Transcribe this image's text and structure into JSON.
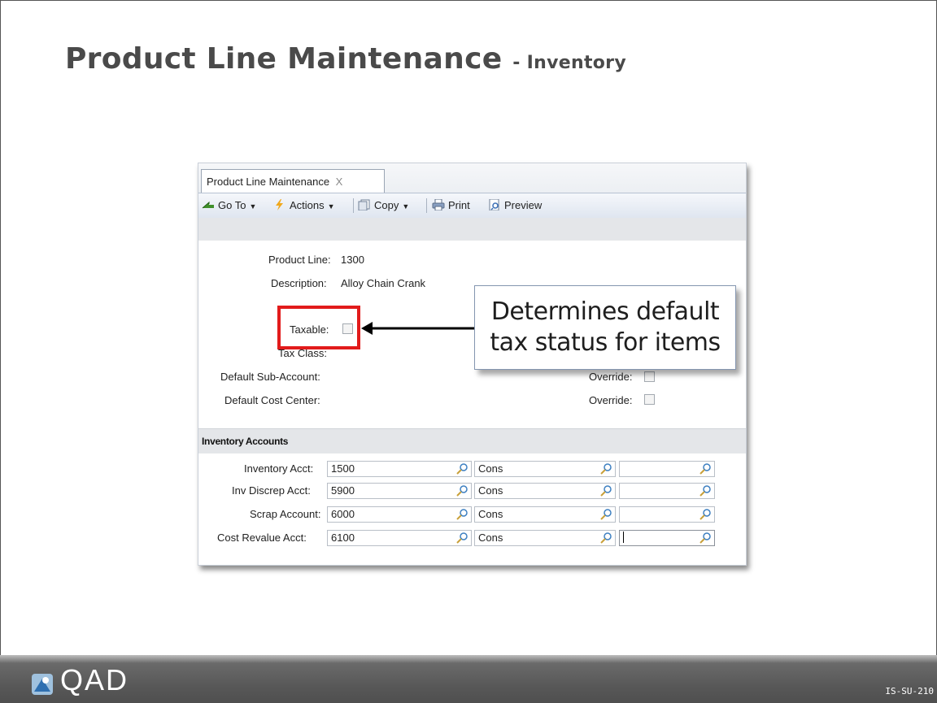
{
  "slide": {
    "title": "Product Line Maintenance",
    "subtitle": "- Inventory",
    "slide_code": "IS-SU-210"
  },
  "app": {
    "tab_label": "Product Line Maintenance",
    "tab_close": "X",
    "toolbar": {
      "goto_label": "Go To",
      "actions_label": "Actions",
      "copy_label": "Copy",
      "print_label": "Print",
      "preview_label": "Preview"
    },
    "fields": {
      "product_line_label": "Product Line:",
      "product_line_value": "1300",
      "description_label": "Description:",
      "description_value": "Alloy Chain Crank",
      "taxable_label": "Taxable:",
      "tax_class_label": "Tax Class:",
      "sub_account_label": "Default Sub-Account:",
      "cost_center_label": "Default Cost Center:",
      "override_label_1": "Override:",
      "override_label_2": "Override:"
    },
    "inventory_section": {
      "title": "Inventory Accounts",
      "rows": [
        {
          "label": "Inventory Acct:",
          "account": "1500",
          "sub": "Cons",
          "cc": ""
        },
        {
          "label": "Inv Discrep Acct:",
          "account": "5900",
          "sub": "Cons",
          "cc": ""
        },
        {
          "label": "Scrap Account:",
          "account": "6000",
          "sub": "Cons",
          "cc": ""
        },
        {
          "label": "Cost Revalue Acct:",
          "account": "6100",
          "sub": "Cons",
          "cc": ""
        }
      ]
    }
  },
  "callout": {
    "line1": "Determines default",
    "line2": "tax status for items"
  },
  "brand": {
    "logo_text": "QAD",
    "accent_red": "#e21b1b"
  }
}
